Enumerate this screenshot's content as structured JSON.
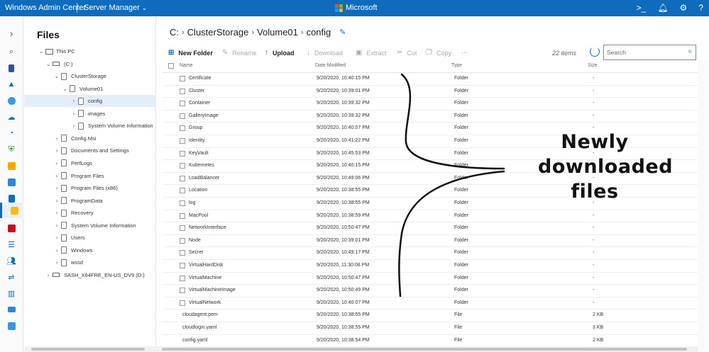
{
  "topbar": {
    "app_name": "Windows Admin Center",
    "context": "Server Manager",
    "brand": "Microsoft",
    "brand_colors": [
      "#f25022",
      "#7fba00",
      "#00a4ef",
      "#ffb900"
    ],
    "bg_color": "#0f6cbd",
    "icons": [
      "terminal-icon",
      "bell-icon",
      "gear-icon",
      "help-icon"
    ]
  },
  "rail": {
    "icons": [
      "expand-chevron-icon",
      "search-icon",
      "overview-icon",
      "azure-icon",
      "backup-icon",
      "cloud-icon",
      "clock-icon",
      "shield-icon",
      "cert-icon",
      "devices-icon",
      "events-icon",
      "files-icon",
      "firewall-icon",
      "list-icon",
      "users-icon",
      "network-icon",
      "performance-icon",
      "window-icon",
      "roles-icon"
    ]
  },
  "tree": {
    "title": "Files",
    "nodes": [
      {
        "label": "This PC",
        "depth": 0,
        "toggle": "v",
        "icon": "pc"
      },
      {
        "label": "(C:)",
        "depth": 1,
        "toggle": "v",
        "icon": "drive"
      },
      {
        "label": "ClusterStorage",
        "depth": 2,
        "toggle": "v",
        "icon": "folder"
      },
      {
        "label": "Volume01",
        "depth": 3,
        "toggle": "v",
        "icon": "folder"
      },
      {
        "label": "config",
        "depth": 4,
        "toggle": ">",
        "icon": "folder",
        "selected": true
      },
      {
        "label": "images",
        "depth": 4,
        "toggle": ">",
        "icon": "folder"
      },
      {
        "label": "System Volume Information",
        "depth": 4,
        "toggle": ">",
        "icon": "folder"
      },
      {
        "label": "Config.Msi",
        "depth": 2,
        "toggle": ">",
        "icon": "folder"
      },
      {
        "label": "Documents and Settings",
        "depth": 2,
        "toggle": ">",
        "icon": "folder"
      },
      {
        "label": "PerfLogs",
        "depth": 2,
        "toggle": ">",
        "icon": "folder"
      },
      {
        "label": "Program Files",
        "depth": 2,
        "toggle": ">",
        "icon": "folder"
      },
      {
        "label": "Program Files (x86)",
        "depth": 2,
        "toggle": ">",
        "icon": "folder"
      },
      {
        "label": "ProgramData",
        "depth": 2,
        "toggle": ">",
        "icon": "folder"
      },
      {
        "label": "Recovery",
        "depth": 2,
        "toggle": ">",
        "icon": "folder"
      },
      {
        "label": "System Volume Information",
        "depth": 2,
        "toggle": ">",
        "icon": "folder"
      },
      {
        "label": "Users",
        "depth": 2,
        "toggle": ">",
        "icon": "folder"
      },
      {
        "label": "Windows",
        "depth": 2,
        "toggle": ">",
        "icon": "folder"
      },
      {
        "label": "wssd",
        "depth": 2,
        "toggle": ">",
        "icon": "folder"
      },
      {
        "label": "SASH_X64FRE_EN-US_DV9 (D:)",
        "depth": 1,
        "toggle": ">",
        "icon": "drive"
      }
    ]
  },
  "breadcrumb": {
    "parts": [
      "C:",
      "ClusterStorage",
      "Volume01",
      "config"
    ]
  },
  "toolbar": {
    "new_folder": "New Folder",
    "rename": "Rename",
    "upload": "Upload",
    "download": "Download",
    "extract": "Extract",
    "cut": "Cut",
    "copy": "Copy",
    "more": "···",
    "item_count": "22 items",
    "search_placeholder": "Search"
  },
  "table": {
    "columns": [
      "Name",
      "Date Modified",
      "Type",
      "Size"
    ],
    "rows": [
      {
        "name": "Certificate",
        "date": "9/20/2020, 10:40:15 PM",
        "type": "Folder",
        "size": "-",
        "icon": "folder"
      },
      {
        "name": "Cluster",
        "date": "9/20/2020, 10:39:01 PM",
        "type": "Folder",
        "size": "-",
        "icon": "folder"
      },
      {
        "name": "Container",
        "date": "9/20/2020, 10:39:32 PM",
        "type": "Folder",
        "size": "-",
        "icon": "folder"
      },
      {
        "name": "GalleryImage",
        "date": "9/20/2020, 10:39:32 PM",
        "type": "Folder",
        "size": "-",
        "icon": "folder"
      },
      {
        "name": "Group",
        "date": "9/20/2020, 10:40:07 PM",
        "type": "Folder",
        "size": "-",
        "icon": "folder"
      },
      {
        "name": "Identity",
        "date": "9/20/2020, 10:41:22 PM",
        "type": "Folder",
        "size": "-",
        "icon": "folder"
      },
      {
        "name": "KeyVault",
        "date": "9/20/2020, 10:45:53 PM",
        "type": "Folder",
        "size": "-",
        "icon": "folder"
      },
      {
        "name": "Kubernetes",
        "date": "9/20/2020, 10:40:15 PM",
        "type": "Folder",
        "size": "-",
        "icon": "folder"
      },
      {
        "name": "LoadBalancer",
        "date": "9/20/2020, 10:49:06 PM",
        "type": "Folder",
        "size": "-",
        "icon": "folder"
      },
      {
        "name": "Location",
        "date": "9/20/2020, 10:38:55 PM",
        "type": "Folder",
        "size": "-",
        "icon": "folder"
      },
      {
        "name": "log",
        "date": "9/20/2020, 10:38:55 PM",
        "type": "Folder",
        "size": "-",
        "icon": "folder"
      },
      {
        "name": "MacPool",
        "date": "9/20/2020, 10:38:59 PM",
        "type": "Folder",
        "size": "-",
        "icon": "folder"
      },
      {
        "name": "NetworkInterface",
        "date": "9/20/2020, 10:50:47 PM",
        "type": "Folder",
        "size": "-",
        "icon": "folder"
      },
      {
        "name": "Node",
        "date": "9/20/2020, 10:39:01 PM",
        "type": "Folder",
        "size": "-",
        "icon": "folder"
      },
      {
        "name": "Secret",
        "date": "9/20/2020, 10:49:17 PM",
        "type": "Folder",
        "size": "-",
        "icon": "folder"
      },
      {
        "name": "VirtualHardDisk",
        "date": "9/20/2020, 11:30:08 PM",
        "type": "Folder",
        "size": "-",
        "icon": "folder"
      },
      {
        "name": "VirtualMachine",
        "date": "9/20/2020, 10:50:47 PM",
        "type": "Folder",
        "size": "-",
        "icon": "folder"
      },
      {
        "name": "VirtualMachineImage",
        "date": "9/20/2020, 10:50:49 PM",
        "type": "Folder",
        "size": "-",
        "icon": "folder"
      },
      {
        "name": "VirtualNetwork",
        "date": "9/20/2020, 10:40:07 PM",
        "type": "Folder",
        "size": "-",
        "icon": "folder"
      },
      {
        "name": "cloudagent.pem",
        "date": "9/20/2020, 10:38:55 PM",
        "type": "File",
        "size": "2 KB",
        "icon": "file"
      },
      {
        "name": "cloudlogin.yaml",
        "date": "9/20/2020, 10:38:55 PM",
        "type": "File",
        "size": "3 KB",
        "icon": "file"
      },
      {
        "name": "config.yaml",
        "date": "9/20/2020, 10:38:54 PM",
        "type": "File",
        "size": "2 KB",
        "icon": "file"
      }
    ]
  },
  "annotation": {
    "lines": [
      "Newly",
      "downloaded",
      "files"
    ]
  }
}
